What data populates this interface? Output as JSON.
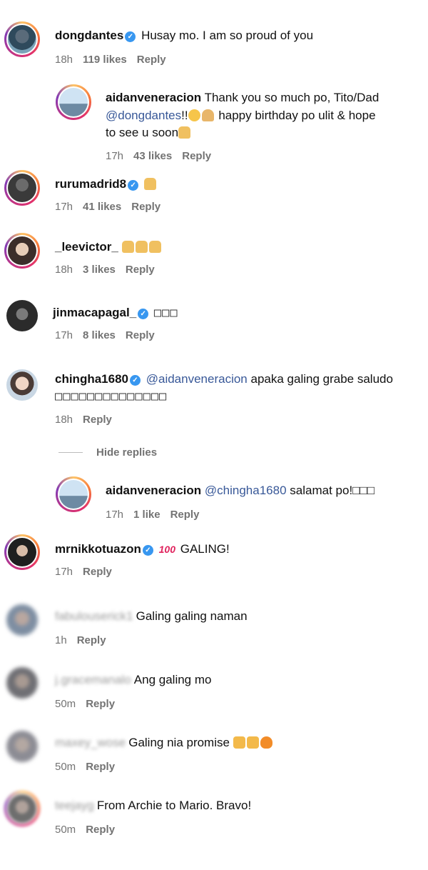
{
  "comments": [
    {
      "user": "dongdantes",
      "verified": true,
      "text": "Husay mo. I am so proud of you",
      "time": "18h",
      "likes": "119 likes",
      "reply": "Reply"
    },
    {
      "user": "aidanveneracion",
      "line1": "Thank you so much po, Tito/Dad",
      "mention": "@dongdantes",
      "after_mention": "!!",
      "line2_rest": "happy birthday po ulit & hope",
      "line3": "to see u soon",
      "time": "17h",
      "likes": "43 likes",
      "reply": "Reply"
    },
    {
      "user": "rurumadrid8",
      "verified": true,
      "time": "17h",
      "likes": "41 likes",
      "reply": "Reply"
    },
    {
      "user": "_leevictor_",
      "time": "18h",
      "likes": "3 likes",
      "reply": "Reply"
    },
    {
      "user": "jinmacapagal_",
      "verified": true,
      "text": "□□□",
      "time": "17h",
      "likes": "8 likes",
      "reply": "Reply"
    },
    {
      "user": "chingha1680",
      "verified": true,
      "mention": "@aidanveneracion",
      "text": "apaka galing grabe saludo",
      "line2": "□□□□□□□□□□□□□□",
      "time": "18h",
      "reply": "Reply"
    },
    {
      "hide_replies": "Hide replies"
    },
    {
      "user": "aidanveneracion",
      "mention": "@chingha1680",
      "text": "salamat po!□□□",
      "time": "17h",
      "likes": "1 like",
      "reply": "Reply"
    },
    {
      "user": "mrnikkotuazon",
      "verified": true,
      "hundred": "100",
      "text": "GALING!",
      "time": "17h",
      "reply": "Reply"
    },
    {
      "user": "fabulouserick1",
      "text": "Galing galing naman",
      "time": "1h",
      "reply": "Reply"
    },
    {
      "user": "j.gracemanalo",
      "text": "Ang galing mo",
      "time": "50m",
      "reply": "Reply"
    },
    {
      "user": "maxey_wose",
      "text": "Galing nia promise",
      "time": "50m",
      "reply": "Reply"
    },
    {
      "user": "teejayg",
      "text": "From Archie to Mario. Bravo!",
      "time": "50m",
      "reply": "Reply"
    }
  ],
  "colors": {
    "avatar_ring": "#e1306c",
    "verified": "#3897f0",
    "mention": "#385898",
    "meta": "#737373"
  }
}
